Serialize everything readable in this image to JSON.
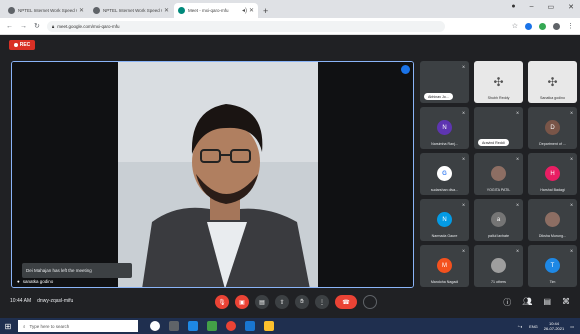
{
  "browser": {
    "tabs": [
      {
        "label": "NPTEL Internet Work Speed Cl...",
        "active": false
      },
      {
        "label": "NPTEL Internet Work Speed Cl...",
        "active": false
      },
      {
        "label": "Meet - mxi-qaro-mfu",
        "active": true
      }
    ],
    "new_tab": "+",
    "address": "meet.google.com/mxi-qaro-mfu"
  },
  "meet": {
    "rec_label": "REC",
    "toast": "Dei Mahajan has left the meeting",
    "main_speaker_name": "sanatka godino",
    "time": "10:44 AM",
    "meeting_code": "dnwy-zqasl-mifu",
    "tiles": [
      {
        "name": "Abhinav Jo...",
        "kind": "pill",
        "color": "#5f6368"
      },
      {
        "name": "Shubh Reddy",
        "kind": "photo-fan",
        "color": "#e8e8e8"
      },
      {
        "name": "Sanatka godino",
        "kind": "photo-fan",
        "color": "#e8e8e8"
      },
      {
        "name": "Narsimha Ranj...",
        "initial": "N",
        "color": "#5e35b1"
      },
      {
        "name": "Aravind Reddi",
        "kind": "pill",
        "color": "#7986cb"
      },
      {
        "name": "Department of ...",
        "initial": "D",
        "color": "#795548"
      },
      {
        "name": "sudarshan diva...",
        "kind": "google",
        "color": "#ffffff"
      },
      {
        "name": "YOGITA PATIL",
        "kind": "photo",
        "color": "#8d6e63"
      },
      {
        "name": "Harshal Badagi",
        "initial": "H",
        "color": "#e91e63"
      },
      {
        "name": "Narmada Gaure",
        "initial": "N",
        "color": "#039be5"
      },
      {
        "name": "pallul lavhate",
        "initial": "a",
        "color": "#757575"
      },
      {
        "name": "Diksha Murung...",
        "kind": "photo",
        "color": "#8d6e63"
      },
      {
        "name": "Mandoha Nagadi",
        "initial": "M",
        "color": "#f4511e"
      },
      {
        "name": "71 others",
        "kind": "others",
        "color": "#3c4043"
      },
      {
        "name": "Tim",
        "initial": "T",
        "color": "#1e88e5"
      }
    ],
    "controls": [
      "mic-off",
      "cam-off",
      "captions",
      "present",
      "hand",
      "more",
      "end-call",
      "more-ring"
    ]
  },
  "taskbar": {
    "search_placeholder": "Type here to search",
    "time": "10:44",
    "date": "26-07-2021",
    "lang": "ENG"
  }
}
